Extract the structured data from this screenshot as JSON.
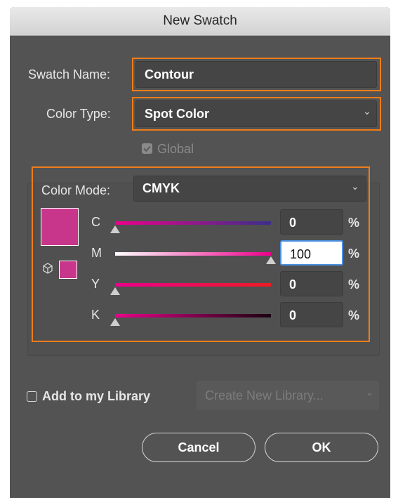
{
  "dialog": {
    "title": "New Swatch"
  },
  "swatch_name": {
    "label": "Swatch Name:",
    "value": "Contour"
  },
  "color_type": {
    "label": "Color Type:",
    "value": "Spot Color"
  },
  "global": {
    "label": "Global",
    "checked": true,
    "disabled": true
  },
  "color_mode": {
    "label": "Color Mode:",
    "value": "CMYK"
  },
  "sliders": [
    {
      "label": "C",
      "value": "0",
      "unit": "%"
    },
    {
      "label": "M",
      "value": "100",
      "unit": "%"
    },
    {
      "label": "Y",
      "value": "0",
      "unit": "%"
    },
    {
      "label": "K",
      "value": "0",
      "unit": "%"
    }
  ],
  "swatch_color": "#c8368c",
  "library": {
    "checkbox_label": "Add to my Library",
    "checked": false,
    "dropdown": "Create New Library..."
  },
  "buttons": {
    "cancel": "Cancel",
    "ok": "OK"
  },
  "colors": {
    "highlight": "#f07d1a",
    "dialog_bg": "#535353",
    "active_input_border": "#4a90e2"
  },
  "icons": [
    "checkbox-checked-icon",
    "chevron-down-icon",
    "spot-color-cube-icon",
    "slider-thumb-icon"
  ]
}
